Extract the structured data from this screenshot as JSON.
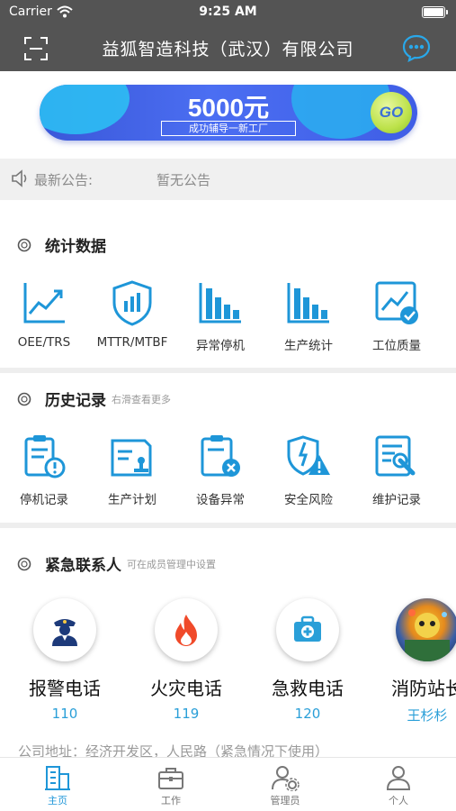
{
  "status_bar": {
    "carrier": "Carrier",
    "time": "9:25 AM"
  },
  "nav": {
    "title": "益狐智造科技（武汉）有限公司"
  },
  "banner": {
    "amount": "5000元",
    "slogan": "成功辅导一新工厂",
    "go": "GO"
  },
  "notice": {
    "label": "最新公告:",
    "value": "暂无公告"
  },
  "stats": {
    "title": "统计数据",
    "items": [
      {
        "label": "OEE/TRS",
        "icon": "trend-chart-icon"
      },
      {
        "label": "MTTR/MTBF",
        "icon": "shield-chart-icon"
      },
      {
        "label": "异常停机",
        "icon": "bar-chart-icon"
      },
      {
        "label": "生产统计",
        "icon": "bar-chart-icon"
      },
      {
        "label": "工位质量",
        "icon": "quality-check-icon"
      }
    ]
  },
  "history": {
    "title": "历史记录",
    "hint": "右滑查看更多",
    "items": [
      {
        "label": "停机记录",
        "icon": "clipboard-alert-icon"
      },
      {
        "label": "生产计划",
        "icon": "stamp-document-icon"
      },
      {
        "label": "设备异常",
        "icon": "clipboard-error-icon"
      },
      {
        "label": "安全风险",
        "icon": "warning-shield-icon"
      },
      {
        "label": "维护记录",
        "icon": "wrench-document-icon"
      }
    ]
  },
  "emergency": {
    "title": "紧急联系人",
    "hint": "可在成员管理中设置",
    "contacts": [
      {
        "name": "报警电话",
        "phone": "110",
        "icon": "police-icon"
      },
      {
        "name": "火灾电话",
        "phone": "119",
        "icon": "fire-icon"
      },
      {
        "name": "急救电话",
        "phone": "120",
        "icon": "first-aid-kit-icon"
      },
      {
        "name": "消防站长",
        "phone": "王杉杉",
        "icon": "avatar-photo"
      }
    ],
    "address": "公司地址：经济开发区，人民路（紧急情况下使用）"
  },
  "tabbar": {
    "items": [
      {
        "label": "主页",
        "icon": "home-building-icon",
        "active": true
      },
      {
        "label": "工作",
        "icon": "briefcase-icon",
        "active": false
      },
      {
        "label": "管理员",
        "icon": "admin-gear-icon",
        "active": false
      },
      {
        "label": "个人",
        "icon": "person-icon",
        "active": false
      }
    ]
  },
  "colors": {
    "accent": "#1e96d8",
    "nav_bg": "#545454",
    "phone": "#2a9fd8"
  }
}
